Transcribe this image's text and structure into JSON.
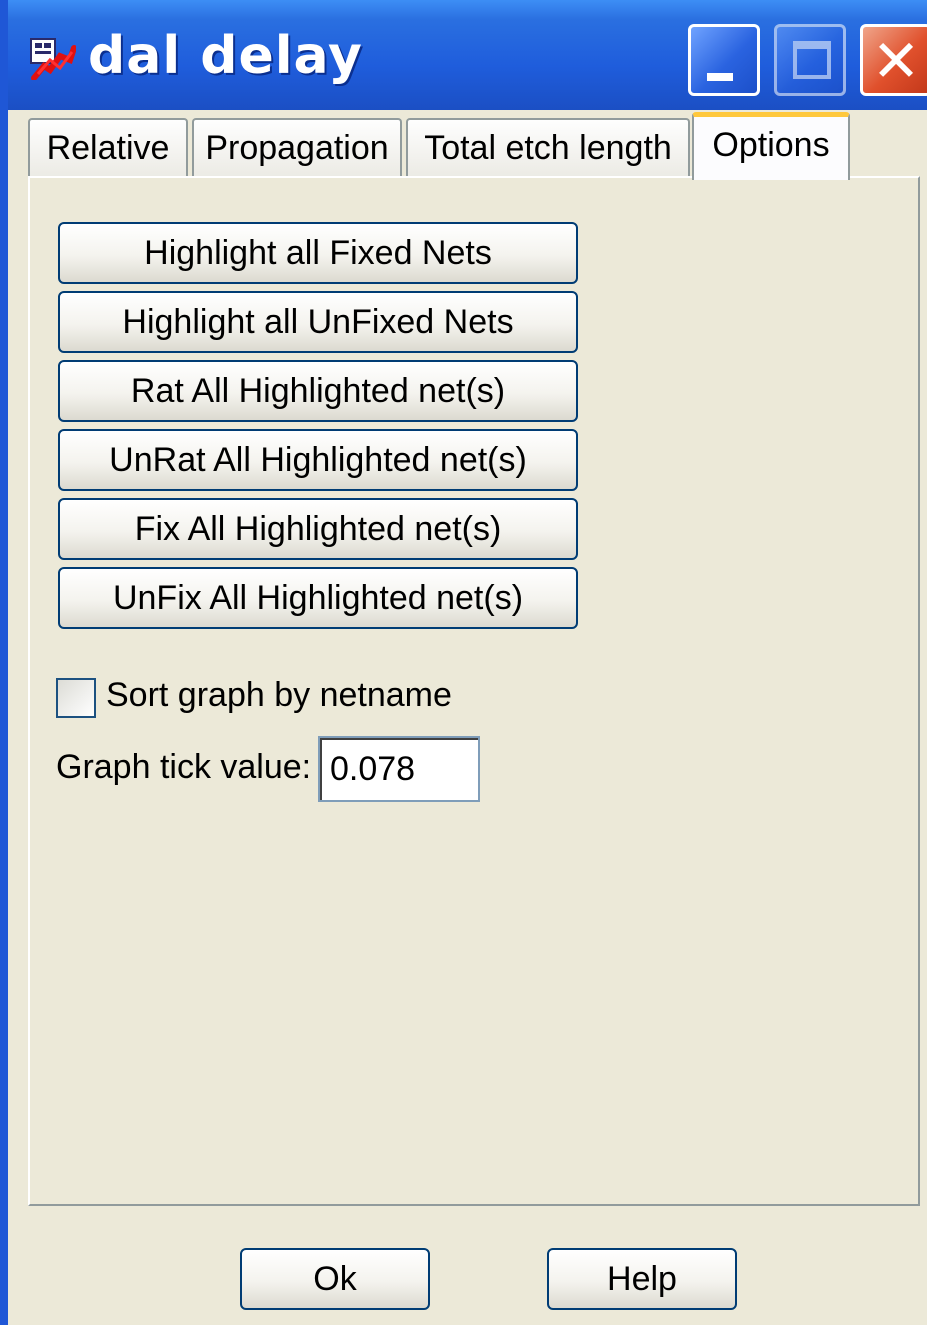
{
  "window": {
    "title": "dal delay",
    "app_icon": "allegro-app-icon",
    "controls": {
      "minimize_icon": "minimize-icon",
      "maximize_icon": "maximize-icon",
      "close_icon": "close-icon",
      "close_glyph": "✕"
    }
  },
  "tabs": [
    {
      "label": "Relative",
      "active": false
    },
    {
      "label": "Propagation",
      "active": false
    },
    {
      "label": "Total etch length",
      "active": false
    },
    {
      "label": "Options",
      "active": true
    }
  ],
  "options": {
    "buttons": [
      "Highlight all Fixed Nets",
      "Highlight all UnFixed Nets",
      "Rat All Highlighted net(s)",
      "UnRat All Highlighted net(s)",
      "Fix All Highlighted net(s)",
      "UnFix All Highlighted net(s)"
    ],
    "sort_checkbox": {
      "label": "Sort graph by netname",
      "checked": false
    },
    "graph_tick": {
      "label": "Graph tick value:",
      "value": "0.078"
    }
  },
  "footer": {
    "ok_label": "Ok",
    "help_label": "Help"
  },
  "colors": {
    "titlebar": "#1f5ddc",
    "window_bg": "#ece9d8",
    "active_tab_accent": "#ffc83c",
    "button_border": "#003c74"
  }
}
